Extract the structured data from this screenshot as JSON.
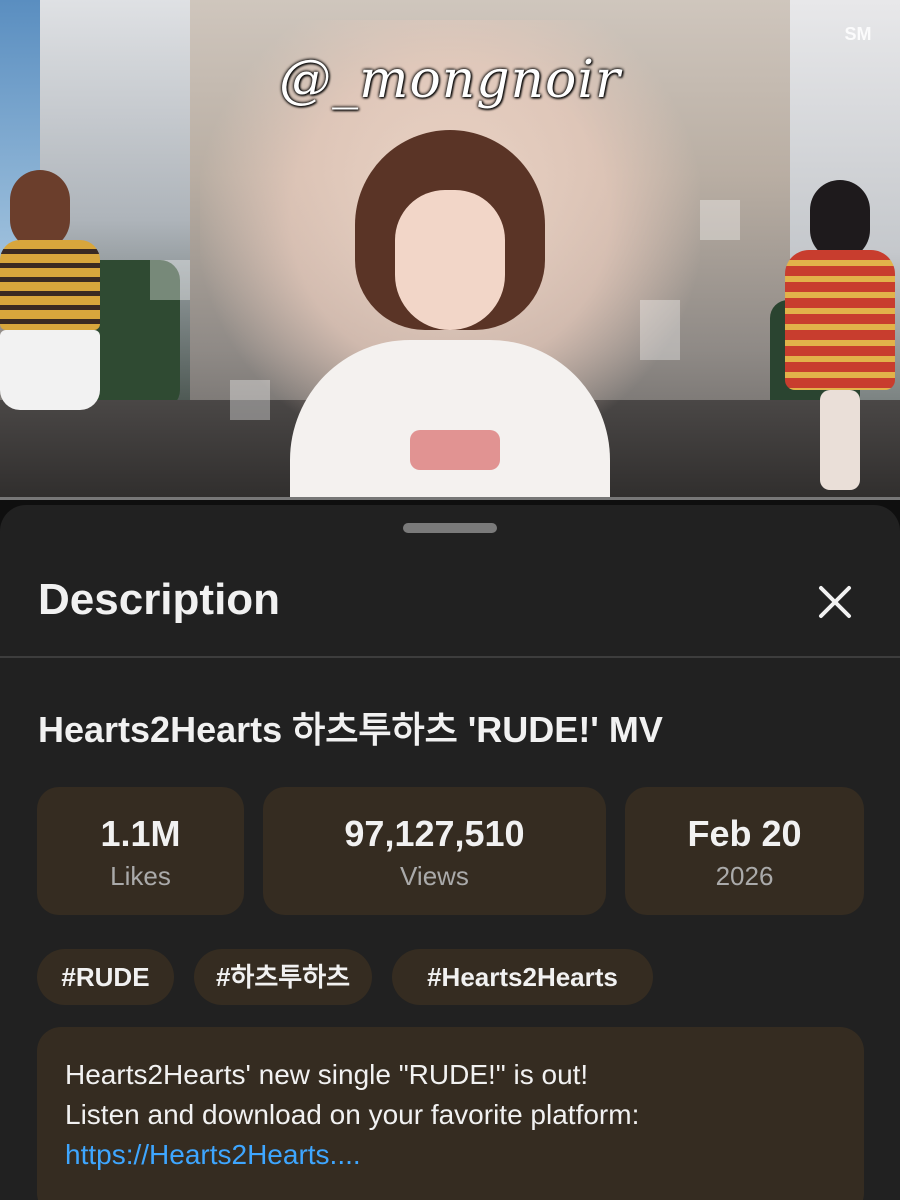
{
  "video": {
    "watermark": "@_mongnoir",
    "channel_mark": "SM"
  },
  "sheet": {
    "title": "Description",
    "close_icon": "close-icon"
  },
  "details": {
    "video_title": "Hearts2Hearts 하츠투하츠 'RUDE!' MV",
    "stats": [
      {
        "value": "1.1M",
        "label": "Likes"
      },
      {
        "value": "97,127,510",
        "label": "Views"
      },
      {
        "value": "Feb 20",
        "label": "2026"
      }
    ],
    "hashtags": [
      "#RUDE",
      "#하츠투하츠",
      "#Hearts2Hearts"
    ],
    "description": {
      "line1": "Hearts2Hearts' new single \"RUDE!\" is out!",
      "line2": "Listen and download on your favorite platform:",
      "link": "https://Hearts2Hearts...."
    }
  },
  "colors": {
    "sheet_bg": "#212121",
    "card_bg": "#352c21",
    "link": "#3ea6ff",
    "muted_text": "#aaaaaa"
  }
}
